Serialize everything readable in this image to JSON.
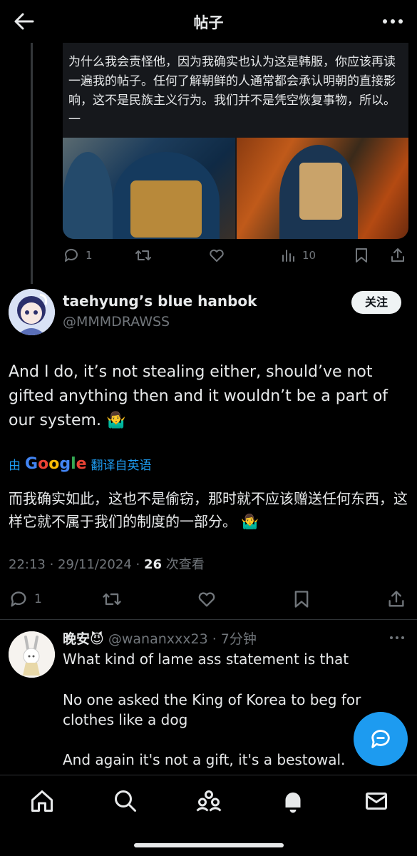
{
  "header": {
    "title": "帖子",
    "back_icon": "arrow-left-icon",
    "more_icon": "more-horizontal-icon"
  },
  "quoted_post": {
    "text": "为什么我会责怪他，因为我确实也认为这是韩服，你应该再读一遍我的帖子。任何了解朝鲜的人通常都会承认明朝的直接影响，这不是民族主义行为。我们并不是凭空恢复事物，所以。一",
    "reply_count": "1",
    "view_count": "10"
  },
  "main_post": {
    "display_name": "taehyung’s blue hanbok",
    "handle": "@MMMDRAWSS",
    "follow_label": "关注",
    "text": "And I do, it’s not stealing either, should’ve not gifted anything then and it wouldn’t be a part of our system. 🤷‍♂️",
    "translate_prefix": "由",
    "translate_brand": "Google",
    "translate_suffix": "翻译自英语",
    "translated_text": "而我确实如此，这也不是偷窃，那时就不应该赠送任何东西，这样它就不属于我们的制度的一部分。 🤷‍♂️",
    "timestamp": "22:13 · 29/11/2024 · ",
    "views": "26",
    "views_label": " 次查看",
    "reply_count": "1"
  },
  "reply": {
    "display_name": "晚安😈",
    "handle_time": " @wananxxx23 · 7分钟",
    "paragraphs": [
      "What kind of lame ass statement is that",
      "No one asked the King of Korea to beg for clothes like a dog",
      "And again it's not a gift, it's a bestowal."
    ]
  },
  "colors": {
    "background": "#000000",
    "text": "#e7e9ea",
    "muted": "#71767b",
    "accent": "#1d9bf0",
    "divider": "#2f3336"
  },
  "nav": {
    "items": [
      "home-icon",
      "search-icon",
      "communities-icon",
      "notifications-bell-icon",
      "messages-envelope-icon"
    ]
  }
}
